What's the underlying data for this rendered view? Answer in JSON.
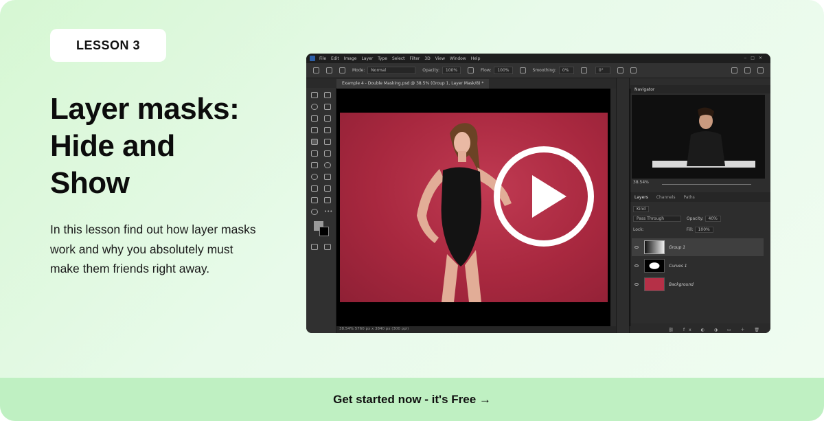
{
  "lesson_badge": "LESSON 3",
  "title_lines": [
    "Layer masks:",
    "Hide and",
    "Show"
  ],
  "description": "In this lesson find out how layer masks work and why you absolutely must make them friends right away.",
  "cta_label": "Get started now - it's Free →",
  "video": {
    "play_icon": "play-icon",
    "menu": [
      "File",
      "Edit",
      "Image",
      "Layer",
      "Type",
      "Select",
      "Filter",
      "3D",
      "View",
      "Window",
      "Help"
    ],
    "options": {
      "mode_label": "Mode:",
      "mode_value": "Normal",
      "opacity_label": "Opacity:",
      "opacity_value": "100%",
      "flow_label": "Flow:",
      "flow_value": "100%",
      "smoothing_label": "Smoothing:",
      "smoothing_value": "0%",
      "angle_value": "0°"
    },
    "doc_tab": "Example 4 - Double Masking.psd @ 38.5% (Group 1, Layer Mask/8) *",
    "status": "38.54%   5760 px x 3840 px (300 ppi)",
    "navigator_title": "Navigator",
    "navigator_zoom": "38.54%",
    "layer_tabs": [
      "Layers",
      "Channels",
      "Paths"
    ],
    "kind_label": "Kind",
    "blend_mode": "Pass Through",
    "opacity_label": "Opacity:",
    "opacity_value": "40%",
    "lock_label": "Lock:",
    "fill_label": "Fill:",
    "fill_value": "100%",
    "layers": [
      "Group 1",
      "Curves 1",
      "Background"
    ]
  },
  "colors": {
    "card_background": "#e2f9e3",
    "cta_bar": "#bff0c2",
    "canvas_backdrop": "#a8283f"
  }
}
